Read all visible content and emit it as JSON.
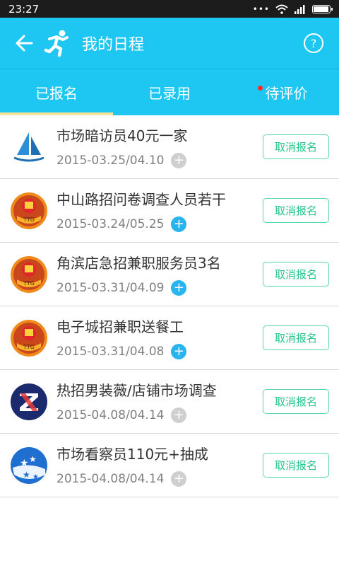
{
  "status": {
    "time": "23:27"
  },
  "header": {
    "title": "我的日程",
    "help_label": "?"
  },
  "tabs": [
    {
      "label": "已报名",
      "active": true,
      "dot": false
    },
    {
      "label": "已录用",
      "active": false,
      "dot": false
    },
    {
      "label": "待评价",
      "active": false,
      "dot": true
    }
  ],
  "items": [
    {
      "title": "市场暗访员40元一家",
      "date": "2015-03.25/04.10",
      "logo": "sailboat-logo",
      "plus": "grey",
      "action": "取消报名"
    },
    {
      "title": "中山路招问卷调查人员若干",
      "date": "2015-03.24/05.25",
      "logo": "orange-badge-logo",
      "plus": "blue",
      "action": "取消报名"
    },
    {
      "title": "角滨店急招兼职服务员3名",
      "date": "2015-03.31/04.09",
      "logo": "orange-badge-logo",
      "plus": "blue",
      "action": "取消报名"
    },
    {
      "title": "电子城招兼职送餐工",
      "date": "2015-03.31/04.08",
      "logo": "orange-badge-logo",
      "plus": "blue",
      "action": "取消报名"
    },
    {
      "title": "热招男装薇/店铺市场调查",
      "date": "2015-04.08/04.14",
      "logo": "navy-z-logo",
      "plus": "grey",
      "action": "取消报名"
    },
    {
      "title": "市场看察员110元+抽成",
      "date": "2015-04.08/04.14",
      "logo": "blue-stars-logo",
      "plus": "grey",
      "action": "取消报名"
    }
  ],
  "plus_symbol": "+",
  "colors": {
    "accent": "#1ec6f2",
    "tab_underline": "#f6e39c",
    "cancel_green": "#24c48c",
    "plus_blue": "#28b4ec",
    "plus_grey": "#cfcfcf"
  },
  "battery_level": 0.95
}
